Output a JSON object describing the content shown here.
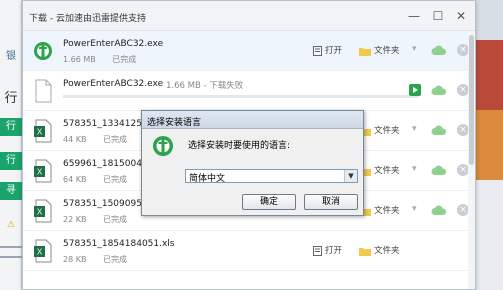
{
  "background": {
    "left_fragments": [
      "银",
      "行",
      "行",
      "寻"
    ],
    "left_heading_fragment": "行"
  },
  "window": {
    "title": "下载 - 云加速由迅雷提供支持"
  },
  "downloads": [
    {
      "name": "PowerEnterABC32.exe",
      "size": "1.66 MB",
      "status": "已完成",
      "icon": "abc-bank-exe-icon",
      "actions": {
        "open": "打开",
        "folder": "文件夹"
      },
      "highlighted": true
    },
    {
      "name": "PowerEnterABC32.exe",
      "size": "1.66 MB",
      "status": "下载失败",
      "icon": "blank-file-icon",
      "failed": true
    },
    {
      "name": "578351_1334125060",
      "size": "44 KB",
      "status": "已完成",
      "icon": "excel-file-icon",
      "actions": {
        "folder": "文件夹"
      }
    },
    {
      "name": "659961_1815004840",
      "size": "64 KB",
      "status": "已完成",
      "icon": "excel-file-icon",
      "actions": {
        "folder": "文件夹"
      }
    },
    {
      "name": "578351_1509095130",
      "size": "22 KB",
      "status": "已完成",
      "icon": "excel-file-icon",
      "actions": {
        "folder": "文件夹"
      }
    },
    {
      "name": "578351_1854184051.xls",
      "size": "28 KB",
      "status": "已完成",
      "icon": "excel-file-icon",
      "actions": {
        "open": "打开",
        "folder": "文件夹"
      }
    }
  ],
  "dialog": {
    "title": "选择安装语言",
    "prompt": "选择安装时要使用的语言:",
    "selected_language": "简体中文",
    "ok_label": "确定",
    "cancel_label": "取消"
  },
  "colors": {
    "accent_green": "#2ba34c",
    "excel_green": "#1e7145",
    "highlight_row": "#eef5fd"
  }
}
